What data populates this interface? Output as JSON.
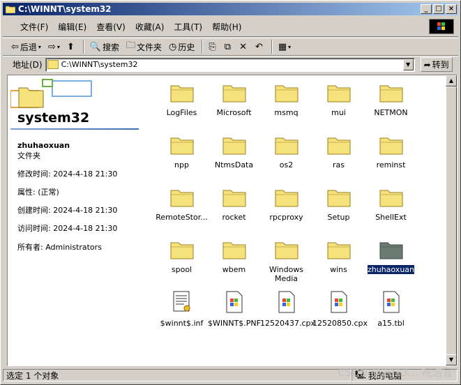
{
  "window": {
    "title": "C:\\WINNT\\system32"
  },
  "menu": [
    "文件(F)",
    "编辑(E)",
    "查看(V)",
    "收藏(A)",
    "工具(T)",
    "帮助(H)"
  ],
  "toolbar": {
    "back": "后退",
    "search": "搜索",
    "folders": "文件夹",
    "history": "历史"
  },
  "address": {
    "label": "地址(D)",
    "value": "C:\\WINNT\\system32",
    "go": "转到"
  },
  "sidebar": {
    "folder_name": "system32",
    "owner_bold": "zhuhaoxuan",
    "type": "文件夹",
    "modified": "修改时间: 2024-4-18 21:30",
    "attributes": "属性: (正常)",
    "created": "创建时间: 2024-4-18 21:30",
    "accessed": "访问时间: 2024-4-18 21:30",
    "owner": "所有者: Administrators"
  },
  "items": [
    {
      "label": "LogFiles"
    },
    {
      "label": "Microsoft"
    },
    {
      "label": "msmq"
    },
    {
      "label": "mui"
    },
    {
      "label": "NETMON"
    },
    {
      "label": "npp"
    },
    {
      "label": "NtmsData"
    },
    {
      "label": "os2"
    },
    {
      "label": "ras"
    },
    {
      "label": "reminst"
    },
    {
      "label": "RemoteStor..."
    },
    {
      "label": "rocket"
    },
    {
      "label": "rpcproxy"
    },
    {
      "label": "Setup"
    },
    {
      "label": "ShellExt"
    },
    {
      "label": "spool"
    },
    {
      "label": "wbem"
    },
    {
      "label": "Windows Media"
    },
    {
      "label": "wins"
    },
    {
      "label": "zhuhaoxuan"
    },
    {
      "label": "$winnt$.inf"
    },
    {
      "label": "$WINNT$.PNF"
    },
    {
      "label": "12520437.cpx"
    },
    {
      "label": "12520850.cpx"
    },
    {
      "label": "a15.tbl"
    }
  ],
  "status": {
    "selected": "选定 1 个对象",
    "computer": "我的电脑"
  },
  "watermark": "CSDN @2023... 祝浩宣"
}
